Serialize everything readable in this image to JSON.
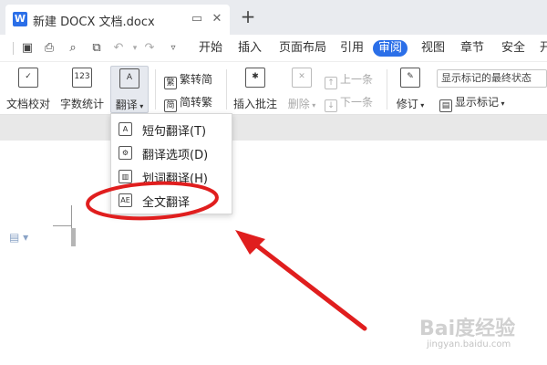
{
  "window": {
    "doc_title": "新建 DOCX 文档.docx",
    "app_icon_letter": "W",
    "new_tab": "+"
  },
  "menu_tabs": [
    "开始",
    "插入",
    "页面布局",
    "引用",
    "审阅",
    "视图",
    "章节",
    "安全",
    "开"
  ],
  "active_tab": "审阅",
  "ribbon": {
    "spell_check": "文档校对",
    "word_count": "字数统计",
    "word_count_icon_text": "123",
    "translate": "翻译",
    "trad_to_simp": "繁转简",
    "simp_to_trad": "简转繁",
    "insert_comment": "插入批注",
    "delete": "删除",
    "prev": "上一条",
    "next": "下一条",
    "track_changes": "修订",
    "markup_mode": "显示标记的最终状态",
    "show_markup": "显示标记"
  },
  "translate_menu": [
    {
      "label": "短句翻译(T)",
      "icon": "short-translate-icon"
    },
    {
      "label": "翻译选项(D)",
      "icon": "translate-options-icon"
    },
    {
      "label": "划词翻译(H)",
      "icon": "word-select-translate-icon"
    },
    {
      "label": "全文翻译",
      "icon": "full-text-translate-icon"
    }
  ],
  "watermark": {
    "main": "Bai度经验",
    "sub": "jingyan.baidu.com"
  },
  "colors": {
    "accent": "#2b6fe8",
    "annotation": "#e01e1e"
  }
}
